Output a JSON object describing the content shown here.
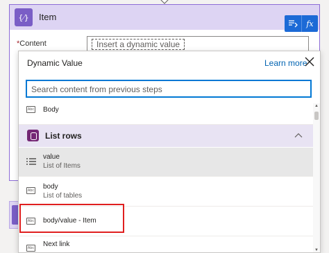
{
  "item_card": {
    "title": "Item",
    "icon_text": "{⁄}",
    "content_label": "Content",
    "required_mark": "*",
    "content_chip": "Insert a dynamic value"
  },
  "toggle": {
    "dynamic_icon": "dynamic-content-icon",
    "fx_label": "fx"
  },
  "flyout": {
    "title": "Dynamic Value",
    "learn_more": "Learn more",
    "search_placeholder": "Search content from previous steps",
    "items_top": [
      {
        "name": "Body"
      }
    ],
    "section": {
      "title": "List rows"
    },
    "items": [
      {
        "name": "value",
        "desc": "List of Items",
        "icon": "list-icon",
        "selected": true
      },
      {
        "name": "body",
        "desc": "List of tables",
        "icon": "text-type-icon"
      },
      {
        "name": "body/value - Item",
        "desc": "",
        "icon": "text-type-icon"
      },
      {
        "name": "Next link",
        "desc": "",
        "icon": "text-type-icon"
      }
    ]
  },
  "colors": {
    "accent": "#0078d4",
    "card_header": "#ddd4f3",
    "section_header": "#e8e3f3",
    "highlight": "#e01e1e",
    "dataverse": "#742774"
  }
}
